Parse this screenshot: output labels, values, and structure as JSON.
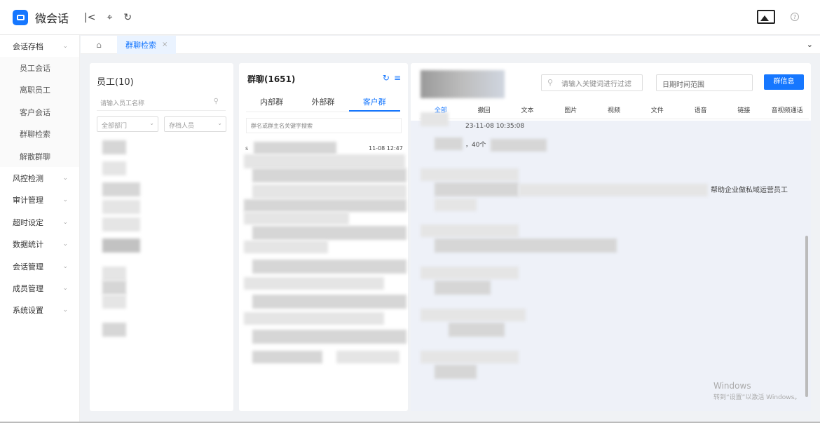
{
  "app": {
    "name": "微会话",
    "accent": "#1677ff"
  },
  "topbar": {
    "icons": [
      "collapse-icon",
      "pin-icon",
      "refresh-icon",
      "image-icon",
      "help-icon"
    ]
  },
  "sidebar": {
    "groups": [
      {
        "label": "会话存档",
        "expanded": true,
        "children": [
          "员工会话",
          "离职员工",
          "客户会话",
          "群聊检索",
          "解散群聊"
        ]
      },
      {
        "label": "风控检测"
      },
      {
        "label": "审计管理"
      },
      {
        "label": "超时设定"
      },
      {
        "label": "数据统计"
      },
      {
        "label": "会话管理"
      },
      {
        "label": "成员管理"
      },
      {
        "label": "系统设置"
      }
    ]
  },
  "tabs": {
    "active": "群聊检索",
    "close": "×"
  },
  "employees": {
    "title": "员工(10)",
    "search_placeholder": "请输入员工名称",
    "dept_select": "全部部门",
    "archive_select": "存档人员"
  },
  "groups": {
    "title": "群聊(1651)",
    "tabs": [
      "内部群",
      "外部群",
      "客户群"
    ],
    "active_tab": "客户群",
    "search_placeholder": "群名或群主名关键字搜索",
    "first_row_time": "11-08 12:47"
  },
  "chat": {
    "search_placeholder": "请输入关键词进行过滤",
    "date_placeholder": "日期时间范围",
    "info_button": "群信息",
    "msg_tabs": [
      "全部",
      "撤回",
      "文本",
      "图片",
      "视频",
      "文件",
      "语音",
      "链接",
      "音视频通话"
    ],
    "active_msg_tab": "全部",
    "timestamp_fragment": "23-11-08 10:35:08",
    "text_fragment_1": "，40个",
    "text_fragment_2": "帮助企业做私域运营员工"
  },
  "watermark": {
    "line1": "Windows",
    "line2": "转到“设置”以激活 Windows。"
  }
}
